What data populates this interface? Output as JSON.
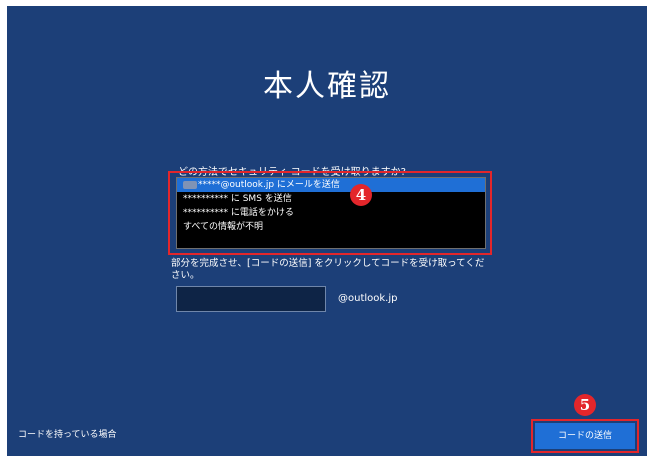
{
  "title": "本人確認",
  "prompt": "どの方法でセキュリティ コードを受け取りますか?",
  "options": [
    {
      "label": "*****@outlook.jp にメールを送信",
      "blurred": true
    },
    {
      "label": "********** に SMS を送信",
      "blurred": true
    },
    {
      "label": "********** に電話をかける",
      "blurred": true
    },
    {
      "label": "すべての情報が不明",
      "blurred": false
    }
  ],
  "selected_option": "*****@outlook.jp にメールを送信",
  "badges": {
    "step4": "4",
    "step5": "5"
  },
  "description": "部分を完成させ、[コードの送信] をクリックしてコードを受け取ってください。",
  "email_input": {
    "value": "",
    "placeholder": ""
  },
  "email_domain": "@outlook.jp",
  "have_code_link": "コードを持っている場合",
  "send_button": "コードの送信",
  "colors": {
    "background": "#1c3f78",
    "accent": "#1f6fd6",
    "highlight": "#e3262b",
    "list_bg": "#000000"
  }
}
